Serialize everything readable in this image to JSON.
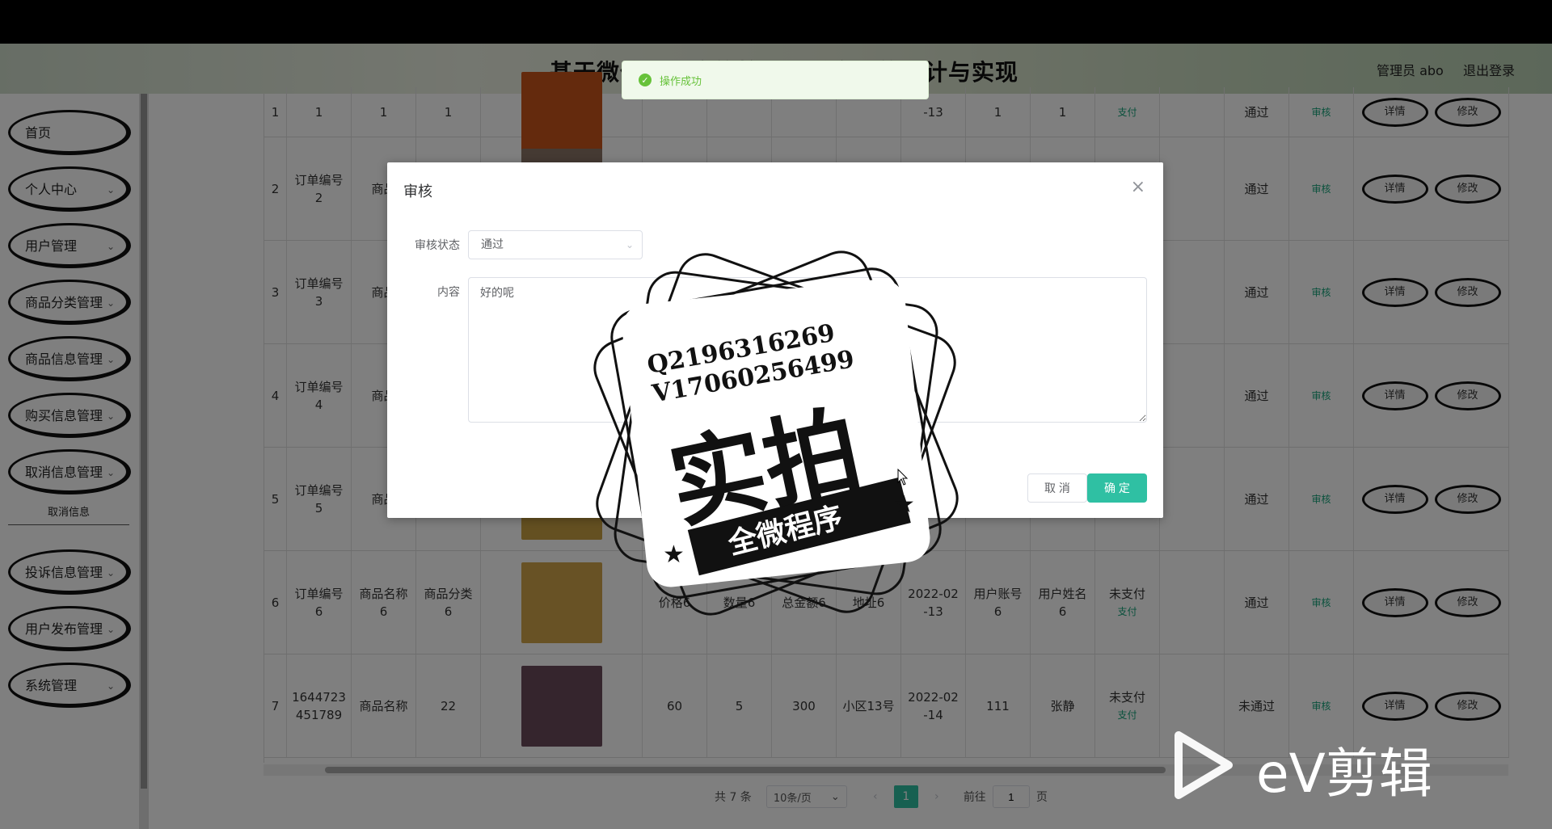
{
  "header": {
    "title": "基于微信小程序的校园二手交易的设计与实现",
    "admin": "管理员 abo",
    "logout": "退出登录"
  },
  "sidebar": {
    "items": [
      {
        "label": "首页",
        "has_chevron": false
      },
      {
        "label": "个人中心",
        "has_chevron": true
      },
      {
        "label": "用户管理",
        "has_chevron": true
      },
      {
        "label": "商品分类管理",
        "has_chevron": true
      },
      {
        "label": "商品信息管理",
        "has_chevron": true
      },
      {
        "label": "购买信息管理",
        "has_chevron": true
      },
      {
        "label": "取消信息管理",
        "has_chevron": true
      },
      {
        "label": "投诉信息管理",
        "has_chevron": true
      },
      {
        "label": "用户发布管理",
        "has_chevron": true
      },
      {
        "label": "系统管理",
        "has_chevron": true
      }
    ],
    "submenu": "取消信息"
  },
  "table": {
    "rows": [
      {
        "idx": "1",
        "order": "1",
        "name": "1",
        "cat": "1",
        "price": "",
        "qty": "",
        "total": "",
        "addr": "",
        "date": "-13",
        "account": "1",
        "uname": "1",
        "pay_status": "",
        "pay_link": "支付",
        "audit": "通过",
        "audit_link": "审核",
        "detail": "详情",
        "edit": "修改",
        "img_color": "#c8541a"
      },
      {
        "idx": "2",
        "order": "订单编号2",
        "name": "商品",
        "cat": "",
        "price": "",
        "qty": "",
        "total": "",
        "addr": "",
        "date": "",
        "account": "",
        "uname": "",
        "pay_status": "",
        "pay_link": "",
        "audit": "通过",
        "audit_link": "审核",
        "detail": "详情",
        "edit": "修改",
        "img_color": "#8a7566"
      },
      {
        "idx": "3",
        "order": "订单编号3",
        "name": "商品",
        "cat": "",
        "price": "",
        "qty": "",
        "total": "",
        "addr": "",
        "date": "",
        "account": "",
        "uname": "",
        "pay_status": "",
        "pay_link": "",
        "audit": "通过",
        "audit_link": "审核",
        "detail": "详情",
        "edit": "修改",
        "img_color": ""
      },
      {
        "idx": "4",
        "order": "订单编号4",
        "name": "商品",
        "cat": "",
        "price": "",
        "qty": "",
        "total": "",
        "addr": "",
        "date": "",
        "account": "",
        "uname": "",
        "pay_status": "",
        "pay_link": "",
        "audit": "通过",
        "audit_link": "审核",
        "detail": "详情",
        "edit": "修改",
        "img_color": ""
      },
      {
        "idx": "5",
        "order": "订单编号5",
        "name": "商品",
        "cat": "",
        "price": "",
        "qty": "",
        "total": "",
        "addr": "",
        "date": "",
        "account": "",
        "uname": "",
        "pay_status": "",
        "pay_link": "",
        "audit": "通过",
        "audit_link": "审核",
        "detail": "详情",
        "edit": "修改",
        "img_color": "#c9a042"
      },
      {
        "idx": "6",
        "order": "订单编号6",
        "name": "商品名称6",
        "cat": "商品分类6",
        "price": "价格6",
        "qty": "数量6",
        "total": "总金额6",
        "addr": "地址6",
        "date": "2022-02-13",
        "account": "用户账号6",
        "uname": "用户姓名6",
        "pay_status": "未支付",
        "pay_link": "支付",
        "audit": "通过",
        "audit_link": "审核",
        "detail": "详情",
        "edit": "修改",
        "img_color": "#d1a54a"
      },
      {
        "idx": "7",
        "order": "1644723451789",
        "name": "商品名称",
        "cat": "22",
        "price": "60",
        "qty": "5",
        "total": "300",
        "addr": "小区13号",
        "date": "2022-02-14",
        "account": "111",
        "uname": "张静",
        "pay_status": "未支付",
        "pay_link": "支付",
        "audit": "未通过",
        "audit_link": "审核",
        "detail": "详情",
        "edit": "修改",
        "img_color": "#6b4a5a"
      }
    ]
  },
  "pager": {
    "total": "共 7 条",
    "page_size": "10条/页",
    "current": "1",
    "goto_label": "前往",
    "goto_value": "1",
    "page_suffix": "页"
  },
  "toast": {
    "text": "操作成功",
    "color": "#67c23a"
  },
  "dialog": {
    "title": "审核",
    "status_label": "审核状态",
    "status_value": "通过",
    "content_label": "内容",
    "content_value": "好的呢",
    "cancel": "取 消",
    "confirm": "确 定",
    "accent": "#2fc0a3"
  },
  "watermark": {
    "line1": "Q2196316269",
    "line2": "V17060256499",
    "big": "实拍",
    "banner": "全微程序"
  },
  "ev_logo": {
    "text": "eV剪辑"
  }
}
